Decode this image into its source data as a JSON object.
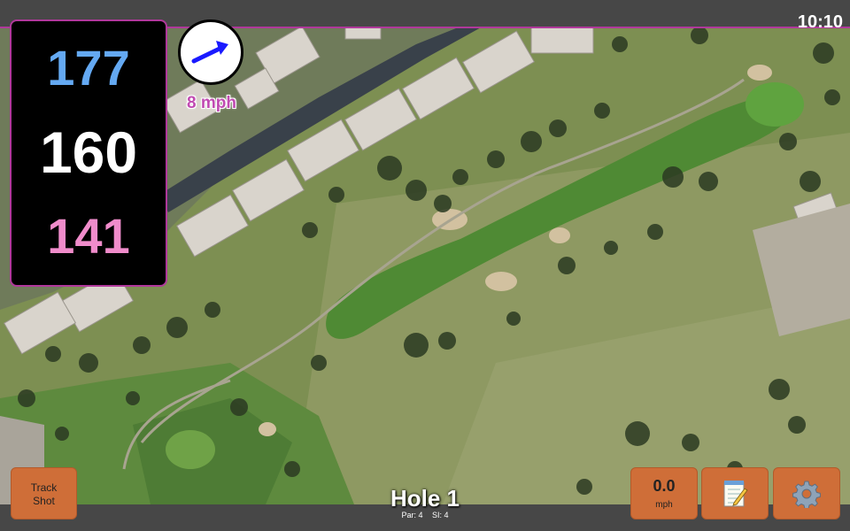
{
  "clock": "10:10",
  "distances": {
    "back": "177",
    "middle": "160",
    "front": "141",
    "back_color": "#64a9f2",
    "middle_color": "#ffffff",
    "front_color": "#f08ccb"
  },
  "wind": {
    "speed": "8 mph",
    "arrow_icon": "wind-direction-arrow-icon",
    "arrow_color": "#1a1aff"
  },
  "hole": {
    "title": "Hole 1",
    "par": "Par: 4",
    "si": "SI: 4"
  },
  "buttons": {
    "track_shot": "Track\nShot",
    "track_shot_line1": "Track",
    "track_shot_line2": "Shot",
    "speed_value": "0.0",
    "speed_unit": "mph",
    "notes_icon": "notepad-icon",
    "settings_icon": "gear-icon"
  },
  "colors": {
    "button": "#cf6e38",
    "panel_border": "#b0389b",
    "bar": "#474747"
  }
}
